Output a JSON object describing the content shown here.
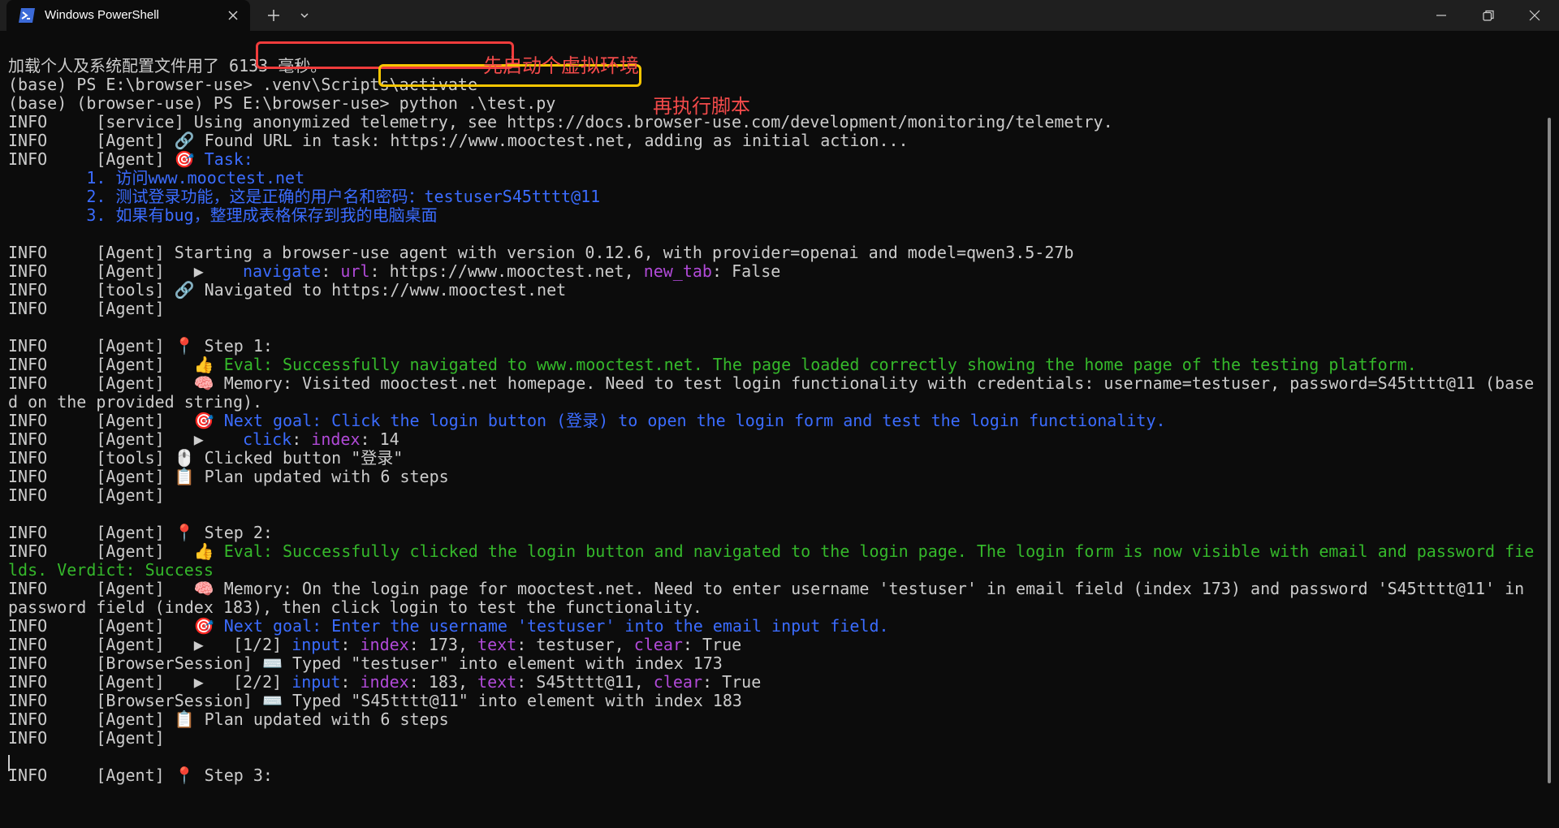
{
  "window": {
    "tab_title": "Windows PowerShell",
    "colors": {
      "titlebar": "#1f1f1f",
      "terminal_bg": "#0c0c0c",
      "text": "#cccccc",
      "blue": "#3b6cff",
      "green": "#35b82b",
      "purple": "#b14ad8"
    }
  },
  "annotations": {
    "first": "先启动个虚拟环境",
    "second": "再执行脚本"
  },
  "lines": [
    {
      "segs": [
        {
          "t": "加载个人及系统配置文件用了 6133 毫秒。"
        }
      ]
    },
    {
      "segs": [
        {
          "t": "(base) PS E:\\browser-use> "
        },
        {
          "t": ".venv\\Scripts\\activate"
        }
      ]
    },
    {
      "segs": [
        {
          "t": "(base) (browser-use) PS E:\\browser-use> "
        },
        {
          "t": "python .\\test.py"
        }
      ]
    },
    {
      "segs": [
        {
          "t": "INFO     [service] Using anonymized telemetry, see https://docs.browser-use.com/development/monitoring/telemetry."
        }
      ]
    },
    {
      "segs": [
        {
          "t": "INFO     [Agent] 🔗 Found URL in task: https://www.mooctest.net, adding as initial action..."
        }
      ]
    },
    {
      "segs": [
        {
          "t": "INFO     [Agent] 🎯 "
        },
        {
          "t": "Task:",
          "c": "blue"
        }
      ]
    },
    {
      "segs": [
        {
          "t": "        1. 访问www.mooctest.net",
          "c": "blue"
        }
      ]
    },
    {
      "segs": [
        {
          "t": "        2. 测试登录功能，这是正确的用户名和密码：testuserS45tttt@11",
          "c": "blue"
        }
      ]
    },
    {
      "segs": [
        {
          "t": "        3. 如果有bug，整理成表格保存到我的电脑桌面",
          "c": "blue"
        }
      ]
    },
    {
      "segs": [
        {
          "t": ""
        }
      ]
    },
    {
      "segs": [
        {
          "t": "INFO     [Agent] Starting a browser-use agent with version 0.12.6, with provider=openai and model=qwen3.5-27b"
        }
      ]
    },
    {
      "segs": [
        {
          "t": "INFO     [Agent]   ▶    "
        },
        {
          "t": "navigate",
          "c": "blue"
        },
        {
          "t": ": "
        },
        {
          "t": "url",
          "c": "purple"
        },
        {
          "t": ": https://www.mooctest.net, "
        },
        {
          "t": "new_tab",
          "c": "purple"
        },
        {
          "t": ": False"
        }
      ]
    },
    {
      "segs": [
        {
          "t": "INFO     [tools] 🔗 Navigated to https://www.mooctest.net"
        }
      ]
    },
    {
      "segs": [
        {
          "t": "INFO     [Agent]"
        }
      ]
    },
    {
      "segs": [
        {
          "t": ""
        }
      ]
    },
    {
      "segs": [
        {
          "t": "INFO     [Agent] 📍 Step 1:"
        }
      ]
    },
    {
      "segs": [
        {
          "t": "INFO     [Agent]   👍 "
        },
        {
          "t": "Eval: Successfully navigated to www.mooctest.net. The page loaded correctly showing the home page of the testing platform.",
          "c": "green"
        }
      ]
    },
    {
      "segs": [
        {
          "t": "INFO     [Agent]   🧠 Memory: Visited mooctest.net homepage. Need to test login functionality with credentials: username=testuser, password=S45tttt@11 (base"
        }
      ]
    },
    {
      "segs": [
        {
          "t": "d on the provided string)."
        }
      ]
    },
    {
      "segs": [
        {
          "t": "INFO     [Agent]   🎯 "
        },
        {
          "t": "Next goal: Click the login button (登录) to open the login form and test the login functionality.",
          "c": "blue"
        }
      ]
    },
    {
      "segs": [
        {
          "t": "INFO     [Agent]   ▶    "
        },
        {
          "t": "click",
          "c": "blue"
        },
        {
          "t": ": "
        },
        {
          "t": "index",
          "c": "purple"
        },
        {
          "t": ": 14"
        }
      ]
    },
    {
      "segs": [
        {
          "t": "INFO     [tools] 🖱️ Clicked button \"登录\""
        }
      ]
    },
    {
      "segs": [
        {
          "t": "INFO     [Agent] 📋 Plan updated with 6 steps"
        }
      ]
    },
    {
      "segs": [
        {
          "t": "INFO     [Agent]"
        }
      ]
    },
    {
      "segs": [
        {
          "t": ""
        }
      ]
    },
    {
      "segs": [
        {
          "t": "INFO     [Agent] 📍 Step 2:"
        }
      ]
    },
    {
      "segs": [
        {
          "t": "INFO     [Agent]   👍 "
        },
        {
          "t": "Eval: Successfully clicked the login button and navigated to the login page. The login form is now visible with email and password fie",
          "c": "green"
        }
      ]
    },
    {
      "segs": [
        {
          "t": "lds. Verdict: Success",
          "c": "green"
        }
      ]
    },
    {
      "segs": [
        {
          "t": "INFO     [Agent]   🧠 Memory: On the login page for mooctest.net. Need to enter username 'testuser' in email field (index 173) and password 'S45tttt@11' in"
        }
      ]
    },
    {
      "segs": [
        {
          "t": "password field (index 183), then click login to test the functionality."
        }
      ]
    },
    {
      "segs": [
        {
          "t": "INFO     [Agent]   🎯 "
        },
        {
          "t": "Next goal: Enter the username 'testuser' into the email input field.",
          "c": "blue"
        }
      ]
    },
    {
      "segs": [
        {
          "t": "INFO     [Agent]   ▶   [1/2] "
        },
        {
          "t": "input",
          "c": "blue"
        },
        {
          "t": ": "
        },
        {
          "t": "index",
          "c": "purple"
        },
        {
          "t": ": 173, "
        },
        {
          "t": "text",
          "c": "purple"
        },
        {
          "t": ": testuser, "
        },
        {
          "t": "clear",
          "c": "purple"
        },
        {
          "t": ": True"
        }
      ]
    },
    {
      "segs": [
        {
          "t": "INFO     [BrowserSession] ⌨️ Typed \"testuser\" into element with index 173"
        }
      ]
    },
    {
      "segs": [
        {
          "t": "INFO     [Agent]   ▶   [2/2] "
        },
        {
          "t": "input",
          "c": "blue"
        },
        {
          "t": ": "
        },
        {
          "t": "index",
          "c": "purple"
        },
        {
          "t": ": 183, "
        },
        {
          "t": "text",
          "c": "purple"
        },
        {
          "t": ": S45tttt@11, "
        },
        {
          "t": "clear",
          "c": "purple"
        },
        {
          "t": ": True"
        }
      ]
    },
    {
      "segs": [
        {
          "t": "INFO     [BrowserSession] ⌨️ Typed \"S45tttt@11\" into element with index 183"
        }
      ]
    },
    {
      "segs": [
        {
          "t": "INFO     [Agent] 📋 Plan updated with 6 steps"
        }
      ]
    },
    {
      "segs": [
        {
          "t": "INFO     [Agent]"
        }
      ]
    },
    {
      "segs": [
        {
          "t": ""
        }
      ]
    },
    {
      "segs": [
        {
          "t": "INFO     [Agent] 📍 Step 3:"
        }
      ]
    }
  ]
}
